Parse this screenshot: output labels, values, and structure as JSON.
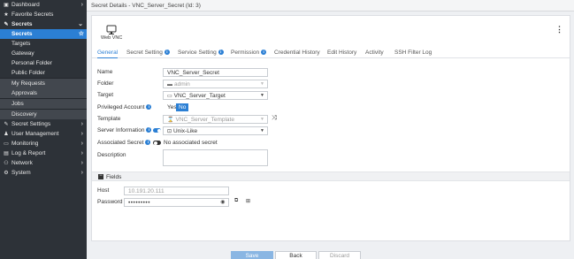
{
  "sidebar": {
    "items": [
      {
        "label": "Dashboard",
        "icon": "dashboard-icon",
        "glyph": "▣",
        "chevron": "›"
      },
      {
        "label": "Favorite Secrets",
        "icon": "star-icon",
        "glyph": "★"
      },
      {
        "label": "Secrets",
        "icon": "key-icon",
        "glyph": "✎",
        "chevron": "⌄"
      },
      {
        "label": "Secrets",
        "selected": true,
        "glyph_right": "☆"
      },
      {
        "label": "Targets"
      },
      {
        "label": "Gateway"
      },
      {
        "label": "Personal Folder"
      },
      {
        "label": "Public Folder"
      },
      {
        "label": "My Requests"
      },
      {
        "label": "Approvals"
      },
      {
        "label": "Jobs"
      },
      {
        "label": "Discovery"
      },
      {
        "label": "Secret Settings",
        "icon": "key-icon",
        "glyph": "✎",
        "chevron": "›"
      },
      {
        "label": "User Management",
        "icon": "user-icon",
        "glyph": "♟",
        "chevron": "›"
      },
      {
        "label": "Monitoring",
        "icon": "monitor-icon",
        "glyph": "▭",
        "chevron": "›"
      },
      {
        "label": "Log & Report",
        "icon": "report-icon",
        "glyph": "▤",
        "chevron": "›"
      },
      {
        "label": "Network",
        "icon": "network-icon",
        "glyph": "⚇",
        "chevron": "›"
      },
      {
        "label": "System",
        "icon": "gear-icon",
        "glyph": "⚙",
        "chevron": "›"
      }
    ]
  },
  "header": {
    "title": "Secret Details - VNC_Server_Secret (Id: 3)"
  },
  "card": {
    "template_name": "Web VNC",
    "kebab": "⋮",
    "tabs": [
      {
        "label": "General",
        "active": true
      },
      {
        "label": "Secret Setting",
        "info": true
      },
      {
        "label": "Service Setting",
        "info": true
      },
      {
        "label": "Permission",
        "info": true
      },
      {
        "label": "Credential History"
      },
      {
        "label": "Edit History"
      },
      {
        "label": "Activity"
      },
      {
        "label": "SSH Filter Log"
      }
    ],
    "info_glyph": "i",
    "form": {
      "name_label": "Name",
      "name_value": "VNC_Server_Secret",
      "folder_label": "Folder",
      "folder_value": "admin",
      "target_label": "Target",
      "target_value": "VNC_Server_Target",
      "privileged_label": "Privileged Account",
      "yes_label": "Yes",
      "no_label": "No",
      "template_label": "Template",
      "template_value": "VNC_Server_Template",
      "server_info_label": "Server Information",
      "server_info_value": "Unix-Like",
      "associated_label": "Associated Secret",
      "associated_value": "No associated secret",
      "description_label": "Description"
    },
    "fields": {
      "section_label": "Fields",
      "host_label": "Host",
      "host_value": "10.191.20.111",
      "password_label": "Password",
      "password_value": "•••••••••"
    }
  },
  "footer": {
    "save_label": "Save",
    "back_label": "Back",
    "discard_label": "Discard"
  },
  "colors": {
    "accent": "#2b7fd4",
    "sidebar_bg": "#2d3238"
  }
}
